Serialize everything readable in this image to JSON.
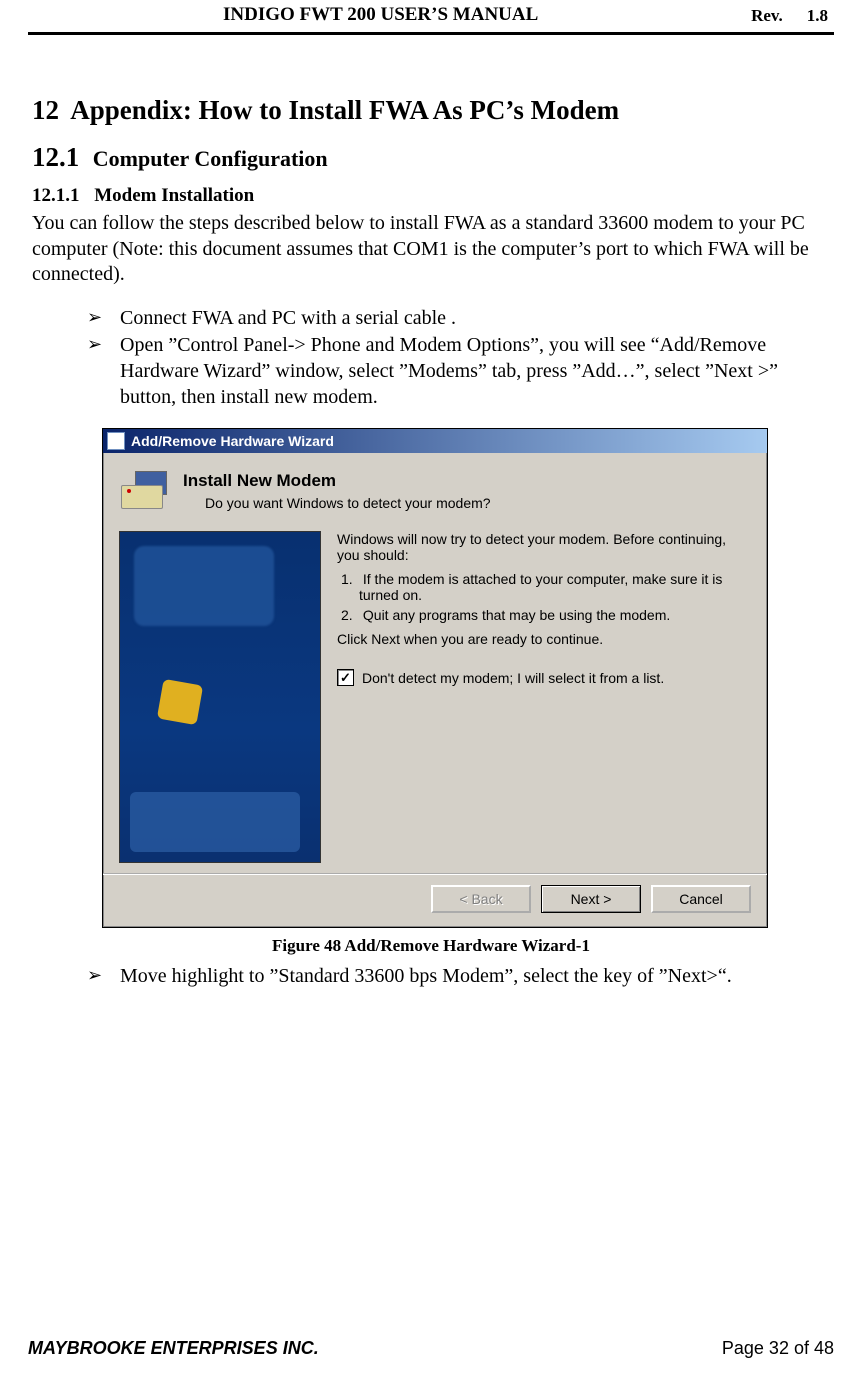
{
  "header": {
    "title": "INDIGO FWT 200 USER’S MANUAL",
    "rev_label": "Rev.",
    "rev_value": "1.8"
  },
  "section": {
    "h1_num": "12",
    "h1_text": "Appendix: How to Install FWA As PC’s Modem",
    "h2_num": "12.1",
    "h2_text": "Computer Configuration",
    "h3_num": "12.1.1",
    "h3_text": "Modem Installation",
    "intro": "You can follow the steps described below to install FWA as a standard 33600 modem to your PC computer (Note: this document assumes that COM1 is the computer’s port to which FWA will be connected).",
    "bullets_top": [
      "Connect FWA and PC with a serial cable .",
      "Open ”Control Panel-> Phone and Modem Options”,  you will see “Add/Remove Hardware Wizard” window,  select ”Modems” tab, press ”Add…”, select ”Next >” button, then install new modem."
    ],
    "figure_caption": "Figure 48 Add/Remove Hardware Wizard-1",
    "bullets_bottom": [
      "Move highlight to  ”Standard 33600 bps Modem”, select the key of ”Next>“."
    ]
  },
  "dialog": {
    "title": "Add/Remove Hardware Wizard",
    "heading": "Install New Modem",
    "subheading": "Do you want Windows to detect your modem?",
    "instr_intro": "Windows will now try to detect your modem.  Before continuing, you should:",
    "instr_items": [
      {
        "marker": "1.",
        "text": "If the modem is attached to your computer, make sure it is turned on."
      },
      {
        "marker": "2.",
        "text": "Quit any programs that may be using the modem."
      }
    ],
    "instr_outro": "Click Next when you are ready to continue.",
    "checkbox_label": "Don't detect my modem; I will select it from a list.",
    "checkbox_checked": "✓",
    "buttons": {
      "back": "< Back",
      "next": "Next >",
      "cancel": "Cancel"
    }
  },
  "footer": {
    "company": "MAYBROOKE ENTERPRISES INC.",
    "pager": "Page 32 of 48"
  }
}
